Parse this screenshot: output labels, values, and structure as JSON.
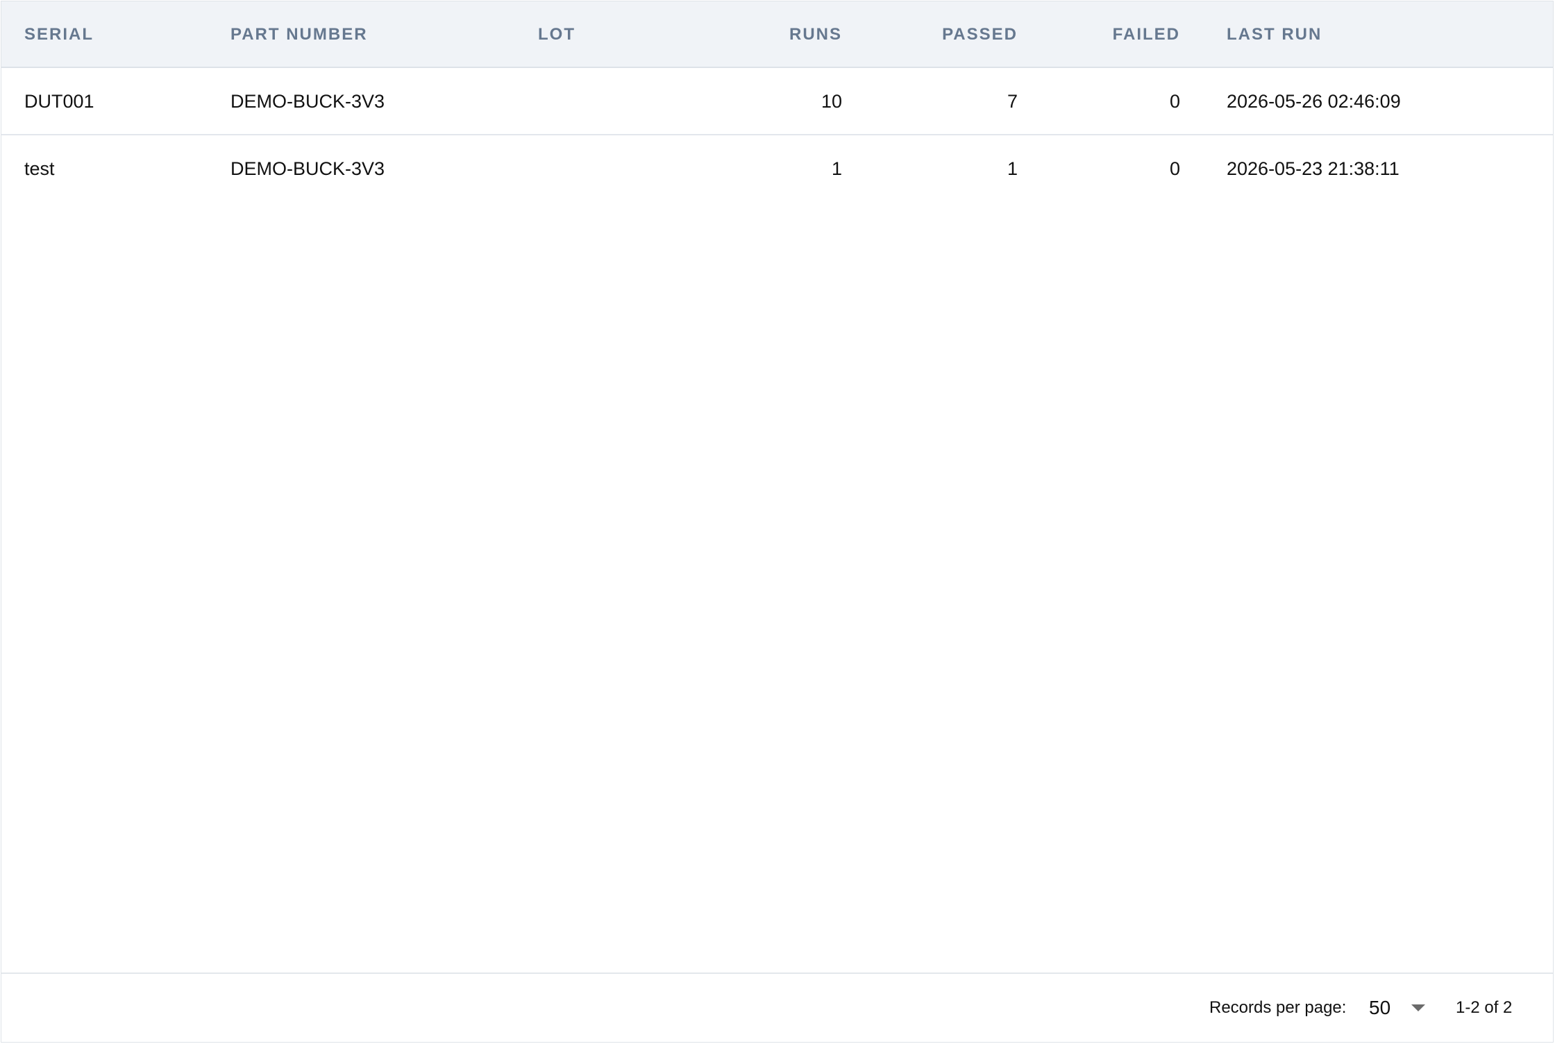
{
  "table": {
    "columns": {
      "serial": "SERIAL",
      "part_number": "PART NUMBER",
      "lot": "LOT",
      "runs": "RUNS",
      "passed": "PASSED",
      "failed": "FAILED",
      "last_run": "LAST RUN"
    },
    "rows": [
      {
        "serial": "DUT001",
        "part_number": "DEMO-BUCK-3V3",
        "lot": "",
        "runs": "10",
        "passed": "7",
        "failed": "0",
        "last_run": "2026-05-26 02:46:09"
      },
      {
        "serial": "test",
        "part_number": "DEMO-BUCK-3V3",
        "lot": "",
        "runs": "1",
        "passed": "1",
        "failed": "0",
        "last_run": "2026-05-23 21:38:11"
      }
    ]
  },
  "footer": {
    "records_per_page_label": "Records per page:",
    "records_per_page_value": "50",
    "range_text": "1-2 of 2"
  },
  "icons": {
    "dropdown": "chevron-down-icon"
  }
}
